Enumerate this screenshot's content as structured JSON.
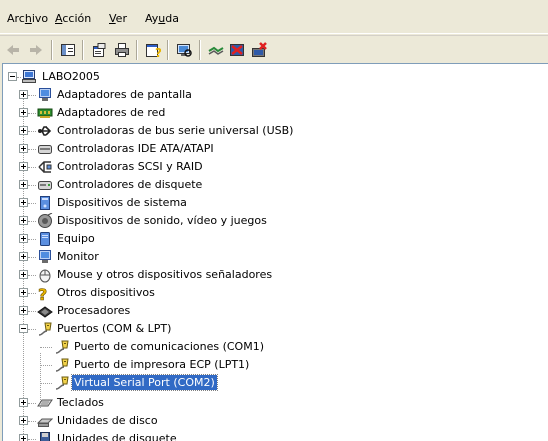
{
  "menu": [
    {
      "pre": "Arc",
      "mn": "h",
      "post": "ivo"
    },
    {
      "pre": "",
      "mn": "A",
      "post": "cción"
    },
    {
      "pre": "",
      "mn": "V",
      "post": "er"
    },
    {
      "pre": "Ay",
      "mn": "u",
      "post": "da"
    }
  ],
  "toolbar": {
    "buttons": [
      "back-arrow-icon",
      "forward-arrow-icon",
      "console-tree-icon",
      "properties-icon",
      "print-icon",
      "help-icon",
      "scan-hardware-icon",
      "update-driver-icon",
      "disable-device-icon",
      "uninstall-device-icon"
    ]
  },
  "tree": {
    "root": "LABO2005",
    "items": [
      {
        "label": "Adaptadores de pantalla",
        "icon": "display-adapter-icon"
      },
      {
        "label": "Adaptadores de red",
        "icon": "network-adapter-icon"
      },
      {
        "label": "Controladoras de bus serie universal (USB)",
        "icon": "usb-icon"
      },
      {
        "label": "Controladoras IDE ATA/ATAPI",
        "icon": "ide-controller-icon"
      },
      {
        "label": "Controladoras SCSI y RAID",
        "icon": "scsi-icon"
      },
      {
        "label": "Controladores de disquete",
        "icon": "floppy-controller-icon"
      },
      {
        "label": "Dispositivos de sistema",
        "icon": "system-device-icon"
      },
      {
        "label": "Dispositivos de sonido, vídeo y juegos",
        "icon": "sound-icon"
      },
      {
        "label": "Equipo",
        "icon": "computer-icon"
      },
      {
        "label": "Monitor",
        "icon": "monitor-icon"
      },
      {
        "label": "Mouse y otros dispositivos señaladores",
        "icon": "mouse-icon"
      },
      {
        "label": "Otros dispositivos",
        "icon": "unknown-device-icon"
      },
      {
        "label": "Procesadores",
        "icon": "processor-icon"
      },
      {
        "label": "Puertos (COM & LPT)",
        "icon": "port-icon"
      },
      {
        "label": "Teclados",
        "icon": "keyboard-icon"
      },
      {
        "label": "Unidades de disco",
        "icon": "disk-drive-icon"
      },
      {
        "label": "Unidades de disquete",
        "icon": "floppy-drive-icon"
      }
    ],
    "ports": [
      "Puerto de comunicaciones (COM1)",
      "Puerto de impresora ECP (LPT1)",
      "Virtual Serial Port (COM2)"
    ],
    "selected": "Virtual Serial Port (COM2)"
  }
}
